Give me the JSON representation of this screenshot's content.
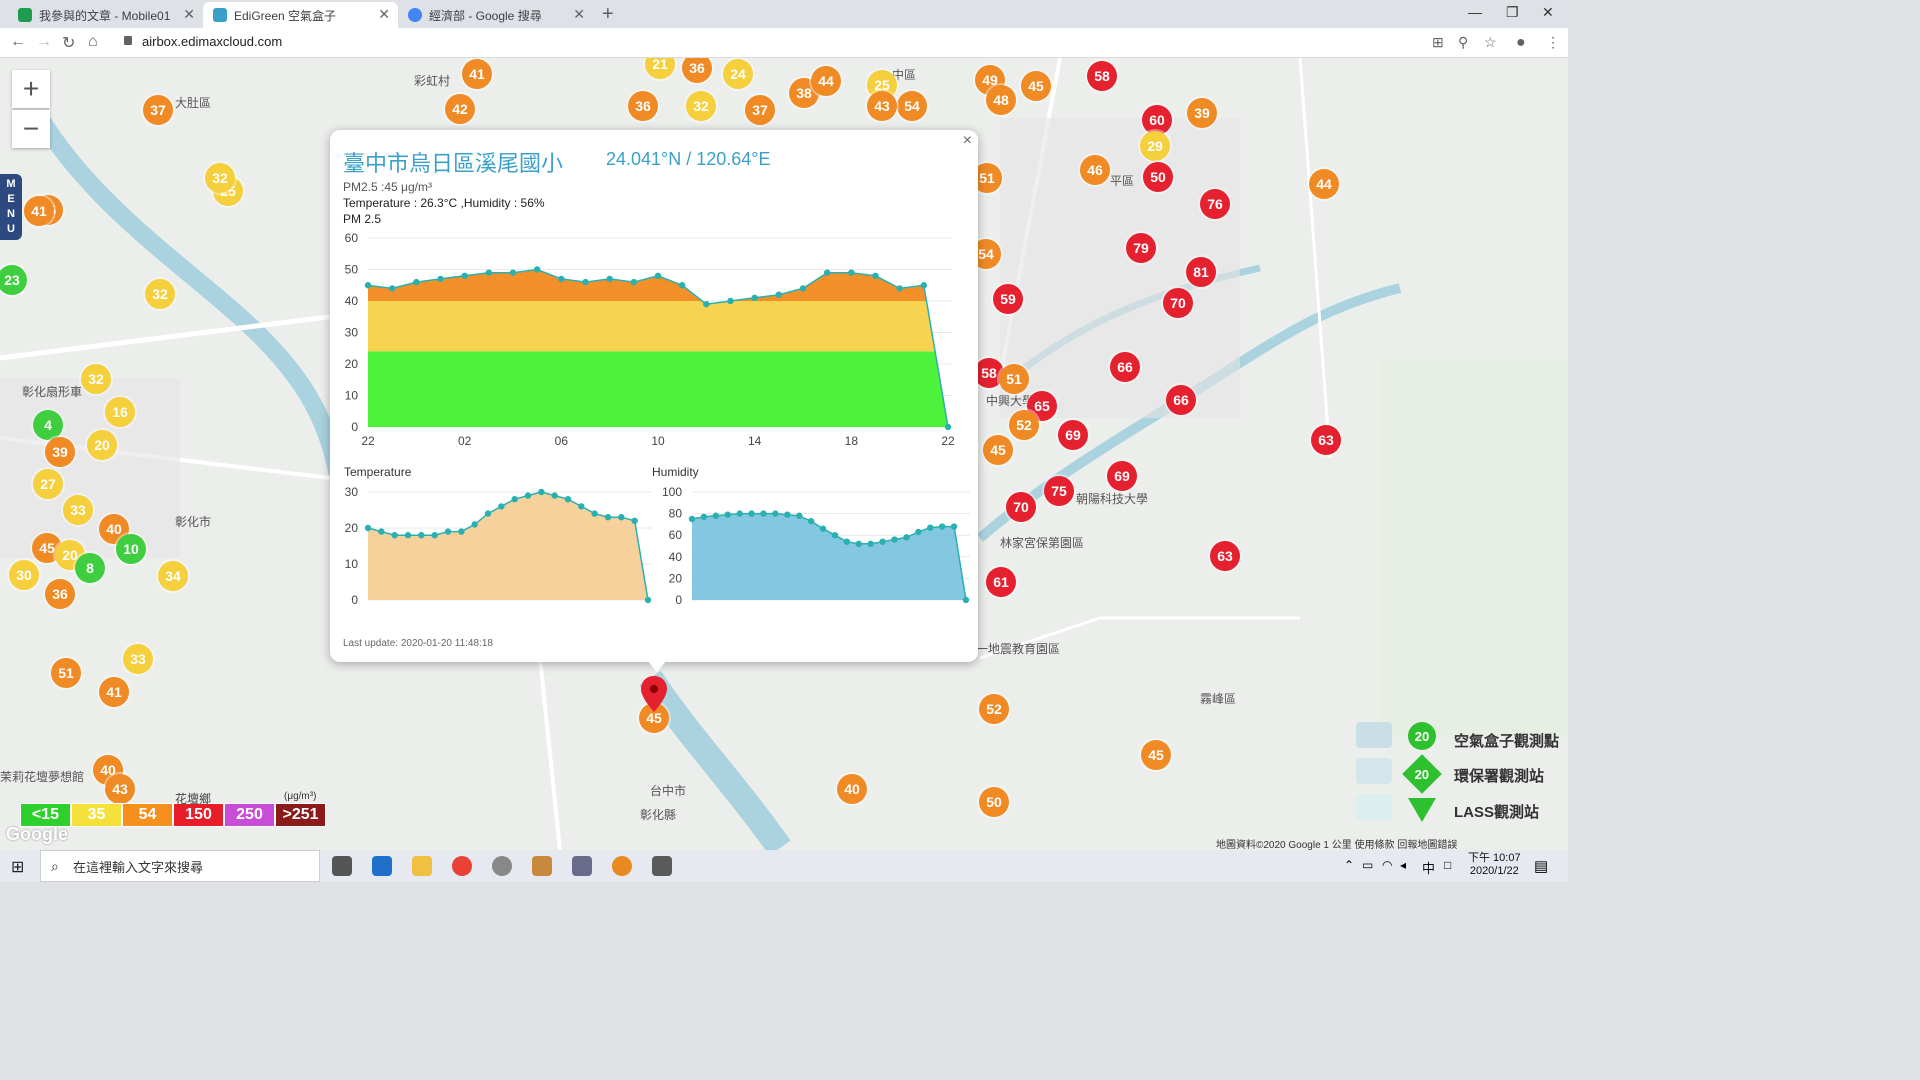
{
  "browser": {
    "tabs": [
      {
        "label": "我參與的文章 - Mobile01",
        "color": "#1f9d4f"
      },
      {
        "label": "EdiGreen 空氣盒子",
        "color": "#3aa0c8"
      },
      {
        "label": "經濟部 - Google 搜尋",
        "color": "#4285f4"
      }
    ],
    "url": "airbox.edimaxcloud.com"
  },
  "map": {
    "zoom_in": "+",
    "zoom_out": "−",
    "menu_label": "MENU",
    "places": [
      "大肚區",
      "彰化扇形車",
      "彰化市",
      "花壇鄉",
      "茉莉花壇夢想館",
      "彩虹村",
      "中區",
      "平區",
      "霧峰區",
      "九二一地震教育園區",
      "林家宮保第園區",
      "中興大學",
      "朝陽科技大學",
      "台中市",
      "彰化縣"
    ],
    "markers": [
      {
        "v": "37",
        "c": "#f08a24"
      },
      {
        "v": "41",
        "c": "#f08a24"
      },
      {
        "v": "42",
        "c": "#f08a24"
      },
      {
        "v": "32",
        "c": "#f5cf3c"
      },
      {
        "v": "32",
        "c": "#f5cf3c"
      },
      {
        "v": "16",
        "c": "#f5cf3c"
      },
      {
        "v": "4",
        "c": "#3fce3f"
      },
      {
        "v": "39",
        "c": "#f08a24"
      },
      {
        "v": "20",
        "c": "#f5cf3c"
      },
      {
        "v": "27",
        "c": "#f5cf3c"
      },
      {
        "v": "33",
        "c": "#f5cf3c"
      },
      {
        "v": "40",
        "c": "#f08a24"
      },
      {
        "v": "10",
        "c": "#3fce3f"
      },
      {
        "v": "45",
        "c": "#f08a24"
      },
      {
        "v": "20",
        "c": "#f5cf3c"
      },
      {
        "v": "8",
        "c": "#3fce3f"
      },
      {
        "v": "30",
        "c": "#f5cf3c"
      },
      {
        "v": "36",
        "c": "#f08a24"
      },
      {
        "v": "34",
        "c": "#f5cf3c"
      },
      {
        "v": "33",
        "c": "#f5cf3c"
      },
      {
        "v": "51",
        "c": "#f08a24"
      },
      {
        "v": "41",
        "c": "#f08a24"
      },
      {
        "v": "40",
        "c": "#f08a24"
      },
      {
        "v": "43",
        "c": "#f08a24"
      },
      {
        "v": "45",
        "c": "#f08a24"
      },
      {
        "v": "40",
        "c": "#f08a24"
      },
      {
        "v": "52",
        "c": "#f08a24"
      },
      {
        "v": "50",
        "c": "#f08a24"
      },
      {
        "v": "45",
        "c": "#f08a24"
      },
      {
        "v": "36",
        "c": "#f08a24"
      },
      {
        "v": "24",
        "c": "#f5cf3c"
      },
      {
        "v": "38",
        "c": "#f08a24"
      },
      {
        "v": "44",
        "c": "#f08a24"
      },
      {
        "v": "25",
        "c": "#f5cf3c"
      },
      {
        "v": "54",
        "c": "#f08a24"
      },
      {
        "v": "49",
        "c": "#f08a24"
      },
      {
        "v": "48",
        "c": "#f08a24"
      },
      {
        "v": "45",
        "c": "#f08a24"
      },
      {
        "v": "58",
        "c": "#e52130"
      },
      {
        "v": "60",
        "c": "#e52130"
      },
      {
        "v": "39",
        "c": "#f08a24"
      },
      {
        "v": "29",
        "c": "#f5cf3c"
      },
      {
        "v": "46",
        "c": "#f08a24"
      },
      {
        "v": "50",
        "c": "#e52130"
      },
      {
        "v": "51",
        "c": "#f08a24"
      },
      {
        "v": "76",
        "c": "#e52130"
      },
      {
        "v": "44",
        "c": "#f08a24"
      },
      {
        "v": "79",
        "c": "#e52130"
      },
      {
        "v": "81",
        "c": "#e52130"
      },
      {
        "v": "54",
        "c": "#f08a24"
      },
      {
        "v": "59",
        "c": "#e52130"
      },
      {
        "v": "70",
        "c": "#e52130"
      },
      {
        "v": "66",
        "c": "#e52130"
      },
      {
        "v": "58",
        "c": "#e52130"
      },
      {
        "v": "51",
        "c": "#f08a24"
      },
      {
        "v": "66",
        "c": "#e52130"
      },
      {
        "v": "65",
        "c": "#e52130"
      },
      {
        "v": "52",
        "c": "#f08a24"
      },
      {
        "v": "69",
        "c": "#e52130"
      },
      {
        "v": "45",
        "c": "#f08a24"
      },
      {
        "v": "63",
        "c": "#e52130"
      },
      {
        "v": "69",
        "c": "#e52130"
      },
      {
        "v": "75",
        "c": "#e52130"
      },
      {
        "v": "70",
        "c": "#e52130"
      },
      {
        "v": "63",
        "c": "#e52130"
      },
      {
        "v": "61",
        "c": "#e52130"
      },
      {
        "v": "45",
        "c": "#f08a24"
      },
      {
        "v": "41",
        "c": "#f08a24"
      },
      {
        "v": "36",
        "c": "#f08a24"
      },
      {
        "v": "32",
        "c": "#f5cf3c"
      },
      {
        "v": "37",
        "c": "#f08a24"
      },
      {
        "v": "43",
        "c": "#f08a24"
      },
      {
        "v": "21",
        "c": "#f5cf3c"
      },
      {
        "v": "25",
        "c": "#f5cf3c"
      },
      {
        "v": "23",
        "c": "#3fce3f"
      },
      {
        "v": "32",
        "c": "#f5cf3c"
      }
    ]
  },
  "popup": {
    "close": "×",
    "title": "臺中市烏日區溪尾國小",
    "coords": "24.041°N / 120.64°E",
    "pm25_line": "PM2.5 :45 μg/m³",
    "temp_hum_line": "Temperature : 26.3°C ,Humidity : 56%",
    "pm_label": "PM 2.5",
    "temp_label": "Temperature",
    "hum_label": "Humidity",
    "last_update": "Last update: 2020-01-20 11:48:18"
  },
  "chart_data": [
    {
      "type": "area",
      "title": "PM 2.5",
      "x": [
        "22",
        "23",
        "00",
        "01",
        "02",
        "03",
        "04",
        "05",
        "06",
        "07",
        "08",
        "09",
        "10",
        "11",
        "12",
        "13",
        "14",
        "15",
        "16",
        "17",
        "18",
        "19",
        "20",
        "21",
        "22"
      ],
      "xticks": [
        "22",
        "02",
        "06",
        "10",
        "14",
        "18",
        "22"
      ],
      "values": [
        45,
        44,
        46,
        47,
        48,
        49,
        49,
        50,
        47,
        46,
        47,
        46,
        48,
        45,
        39,
        40,
        41,
        42,
        44,
        49,
        49,
        48,
        44,
        45,
        0
      ],
      "ylim": [
        0,
        60
      ],
      "yticks": [
        0,
        10,
        20,
        30,
        40,
        50,
        60
      ],
      "bands": [
        {
          "from": 0,
          "to": 24,
          "color": "#4cf23c"
        },
        {
          "from": 24,
          "to": 40,
          "color": "#f8d34f"
        },
        {
          "from": 40,
          "to": 60,
          "color": "#f4902a"
        }
      ]
    },
    {
      "type": "area",
      "title": "Temperature",
      "values": [
        20,
        19,
        18,
        18,
        18,
        18,
        19,
        19,
        21,
        24,
        26,
        28,
        29,
        30,
        29,
        28,
        26,
        24,
        23,
        23,
        22,
        0
      ],
      "ylim": [
        0,
        30
      ],
      "yticks": [
        0,
        10,
        20,
        30
      ],
      "color": "#f6c98a"
    },
    {
      "type": "area",
      "title": "Humidity",
      "values": [
        75,
        77,
        78,
        79,
        80,
        80,
        80,
        80,
        79,
        78,
        73,
        66,
        60,
        54,
        52,
        52,
        54,
        56,
        58,
        63,
        67,
        68,
        68,
        0
      ],
      "ylim": [
        0,
        100
      ],
      "yticks": [
        0,
        20,
        40,
        60,
        80,
        100
      ],
      "color": "#6fbddb"
    }
  ],
  "legend": {
    "bins": [
      {
        "label": "<15",
        "color": "#2ed02e"
      },
      {
        "label": "35",
        "color": "#f5e13c"
      },
      {
        "label": "54",
        "color": "#f5901f"
      },
      {
        "label": "150",
        "color": "#e61e28"
      },
      {
        "label": "250",
        "color": "#c84cd8"
      },
      {
        "label": ">251",
        "color": "#8b1a1a"
      }
    ],
    "unit": "(μg/m³)",
    "stations": [
      {
        "label": "空氣盒子觀測點",
        "badge": "20"
      },
      {
        "label": "環保署觀測站",
        "badge": "20"
      },
      {
        "label": "LASS觀測站",
        "badge": "20"
      }
    ],
    "attribution": "地圖資料©2020 Google   1 公里          使用條款   回報地圖錯誤",
    "google": "Google"
  },
  "taskbar": {
    "search_placeholder": "在這裡輸入文字來搜尋",
    "ime": "中",
    "time": "下午 10:07",
    "date": "2020/1/22"
  }
}
